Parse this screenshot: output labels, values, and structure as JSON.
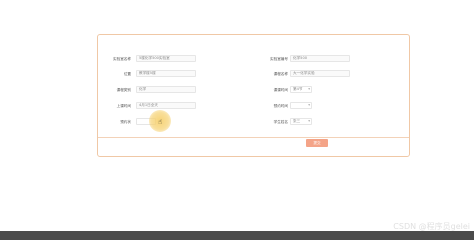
{
  "form": {
    "lab_name": {
      "label": "实验室名称",
      "value": "5楼化学500实验室"
    },
    "lab_number": {
      "label": "实验室编号",
      "value": "化学500"
    },
    "location": {
      "label": "位置",
      "value": "教学楼5楼"
    },
    "course_name": {
      "label": "课程名称",
      "value": "大一化学实验"
    },
    "course_type": {
      "label": "课程类别",
      "value": "化学"
    },
    "course_session": {
      "label": "课课时间",
      "value": "第4节"
    },
    "class_time": {
      "label": "上课时间",
      "value": "4月1日全天"
    },
    "class_duration": {
      "label": "预约时间",
      "value": ""
    },
    "booking": {
      "label": "预约状",
      "value": ""
    },
    "student_name": {
      "label": "学生姓名",
      "value": "张三"
    },
    "submit_label": "提交"
  },
  "watermark": "CSDN @程序员gelei"
}
